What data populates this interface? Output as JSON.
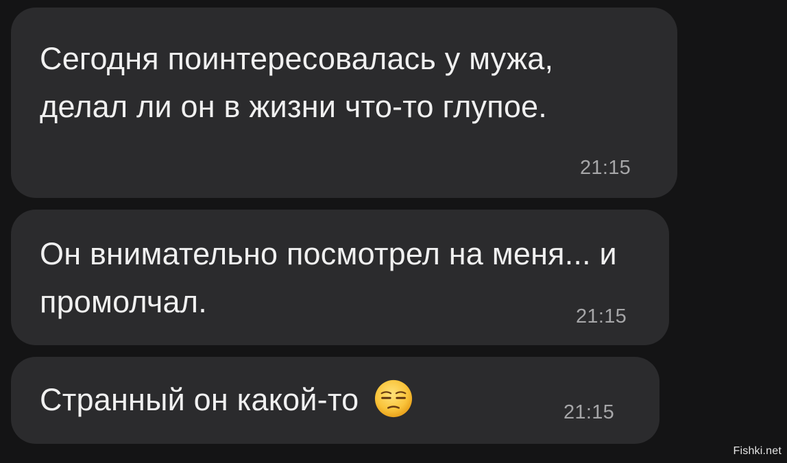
{
  "messages": [
    {
      "text": "Сегодня поинтересовалась у мужа, делал ли он в жизни что-то глупое.",
      "time": "21:15"
    },
    {
      "text": "Он внимательно посмотрел на меня... и промолчал.",
      "time": "21:15"
    },
    {
      "text": "Странный он какой-то",
      "emoji": "unamused-face-emoji",
      "time": "21:15"
    }
  ],
  "watermark": "Fishki.net",
  "colors": {
    "background": "#141415",
    "bubble": "#2b2b2d",
    "text": "#f0f0f0",
    "timestamp": "#a6a6a8"
  }
}
